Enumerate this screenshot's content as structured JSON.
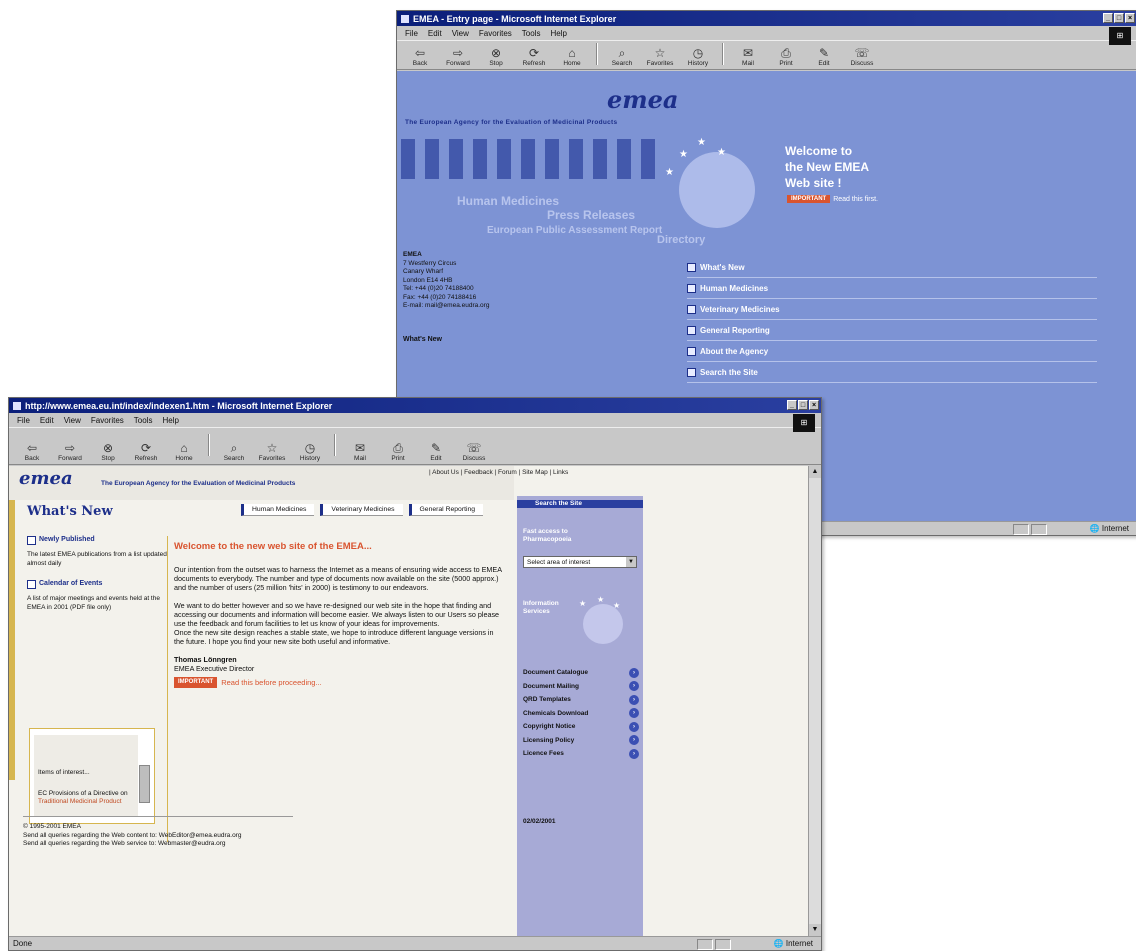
{
  "back_window": {
    "title": "EMEA - Entry page - Microsoft Internet Explorer",
    "menu": [
      "File",
      "Edit",
      "View",
      "Favorites",
      "Tools",
      "Help"
    ],
    "toolbar": [
      "Back",
      "Forward",
      "Stop",
      "Refresh",
      "Home",
      "Search",
      "Favorites",
      "History",
      "Mail",
      "Print",
      "Edit",
      "Discuss"
    ],
    "logo": "emea",
    "tagline": "The European Agency for the Evaluation of Medicinal Products",
    "welcome": [
      "Welcome to",
      "the New EMEA",
      "Web site !"
    ],
    "important_label": "IMPORTANT",
    "important_text": "Read this first.",
    "address": [
      "EMEA",
      "7 Westferry Circus",
      "Canary Wharf",
      "London E14 4HB",
      "Tel: +44 (0)20 74188400",
      "Fax: +44 (0)20 74188416",
      "E-mail: mail@emea.eudra.org"
    ],
    "sitemap": "What's New",
    "nav": [
      "What's New",
      "Human Medicines",
      "Veterinary Medicines",
      "General Reporting",
      "About the Agency",
      "Search the Site"
    ],
    "status": "Internet"
  },
  "front_window": {
    "title": "http://www.emea.eu.int/index/indexen1.htm - Microsoft Internet Explorer",
    "menu": [
      "File",
      "Edit",
      "View",
      "Favorites",
      "Tools",
      "Help"
    ],
    "toolbar": [
      "Back",
      "Forward",
      "Stop",
      "Refresh",
      "Home",
      "Search",
      "Favorites",
      "History",
      "Mail",
      "Print",
      "Edit",
      "Discuss"
    ],
    "logo": "emea",
    "tagline": "The European Agency for the Evaluation of Medicinal Products",
    "toplinks": "| About Us | Feedback | Forum | Site Map | Links",
    "page_title": "What's New",
    "tabs": [
      "Human Medicines",
      "Veterinary Medicines",
      "General Reporting"
    ],
    "newly_published_title": "Newly Published",
    "newly_published_text": "The latest EMEA publications from a list updated almost daily",
    "calendar_title": "Calendar of Events",
    "calendar_text": "A list of major meetings and events held at the EMEA in 2001 (PDF file only)",
    "box_items": [
      "Items of interest...",
      "EC Provisions of a Directive on",
      "Traditional Medicinal Product"
    ],
    "welcome_heading": "Welcome to the new web site of the EMEA...",
    "para1": "Our intention from the outset was to harness the Internet as a means of ensuring wide access to EMEA documents to everybody. The number and type of documents now available on the site (5000 approx.) and the number of users (25 million 'hits' in 2000) is testimony to our endeavors.",
    "para2": "We want to do better however and so we have re-designed our web site in the hope that finding and accessing our documents and information will become easier. We always listen to our Users so please use the feedback and forum facilities to let us know of your ideas for improvements.",
    "para3": "Once the new site design reaches a stable state, we hope to introduce different language versions in the future. I hope you find your new site both useful and informative.",
    "signature_name": "Thomas Lönngren",
    "signature_role": "EMEA Executive Director",
    "important_label": "IMPORTANT",
    "proceed_text": "Read this before proceeding...",
    "footer": [
      "© 1995-2001 EMEA",
      "Send all queries regarding the Web content to: WebEditor@emea.eudra.org",
      "Send all queries regarding the Web service to: Webmaster@eudra.org"
    ],
    "right_top": "Search the Site",
    "right_fast": "Fast access to",
    "right_fast2": "Pharmacopoeia",
    "select_value": "Select area of interest",
    "right_info": "Information",
    "right_info2": "Services",
    "right_links": [
      "Document Catalogue",
      "Document Mailing",
      "QRD Templates",
      "Chemicals Download",
      "Copyright Notice",
      "Licensing Policy",
      "Licence Fees"
    ],
    "right_date": "02/02/2001",
    "status_left": "Done",
    "status_zone": "Internet"
  }
}
